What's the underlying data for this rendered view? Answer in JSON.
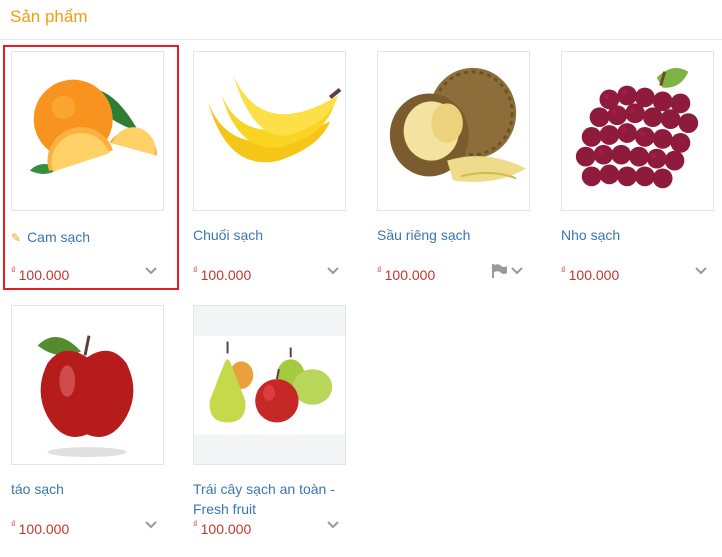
{
  "section": {
    "title": "Sản phẩm"
  },
  "currency_symbol": "₫",
  "products": [
    {
      "name": "Cam sạch",
      "price": "100.000",
      "image": "orange-fruit"
    },
    {
      "name": "Chuối sạch",
      "price": "100.000",
      "image": "banana-fruit"
    },
    {
      "name": "Sầu riêng sạch",
      "price": "100.000",
      "image": "durian-fruit"
    },
    {
      "name": "Nho sạch",
      "price": "100.000",
      "image": "grape-fruit"
    },
    {
      "name": "táo sạch",
      "price": "100.000",
      "image": "apple-fruit"
    },
    {
      "name": "Trái cây sạch an toàn - Fresh fruit",
      "price": "100.000",
      "image": "mixed-fruit"
    }
  ],
  "colors": {
    "title": "#f39c12",
    "link": "#3a76b0",
    "price": "#c0392b",
    "selection_border": "#e02020"
  },
  "icons": [
    "pin-icon",
    "chevron-down-icon",
    "flag-icon"
  ]
}
